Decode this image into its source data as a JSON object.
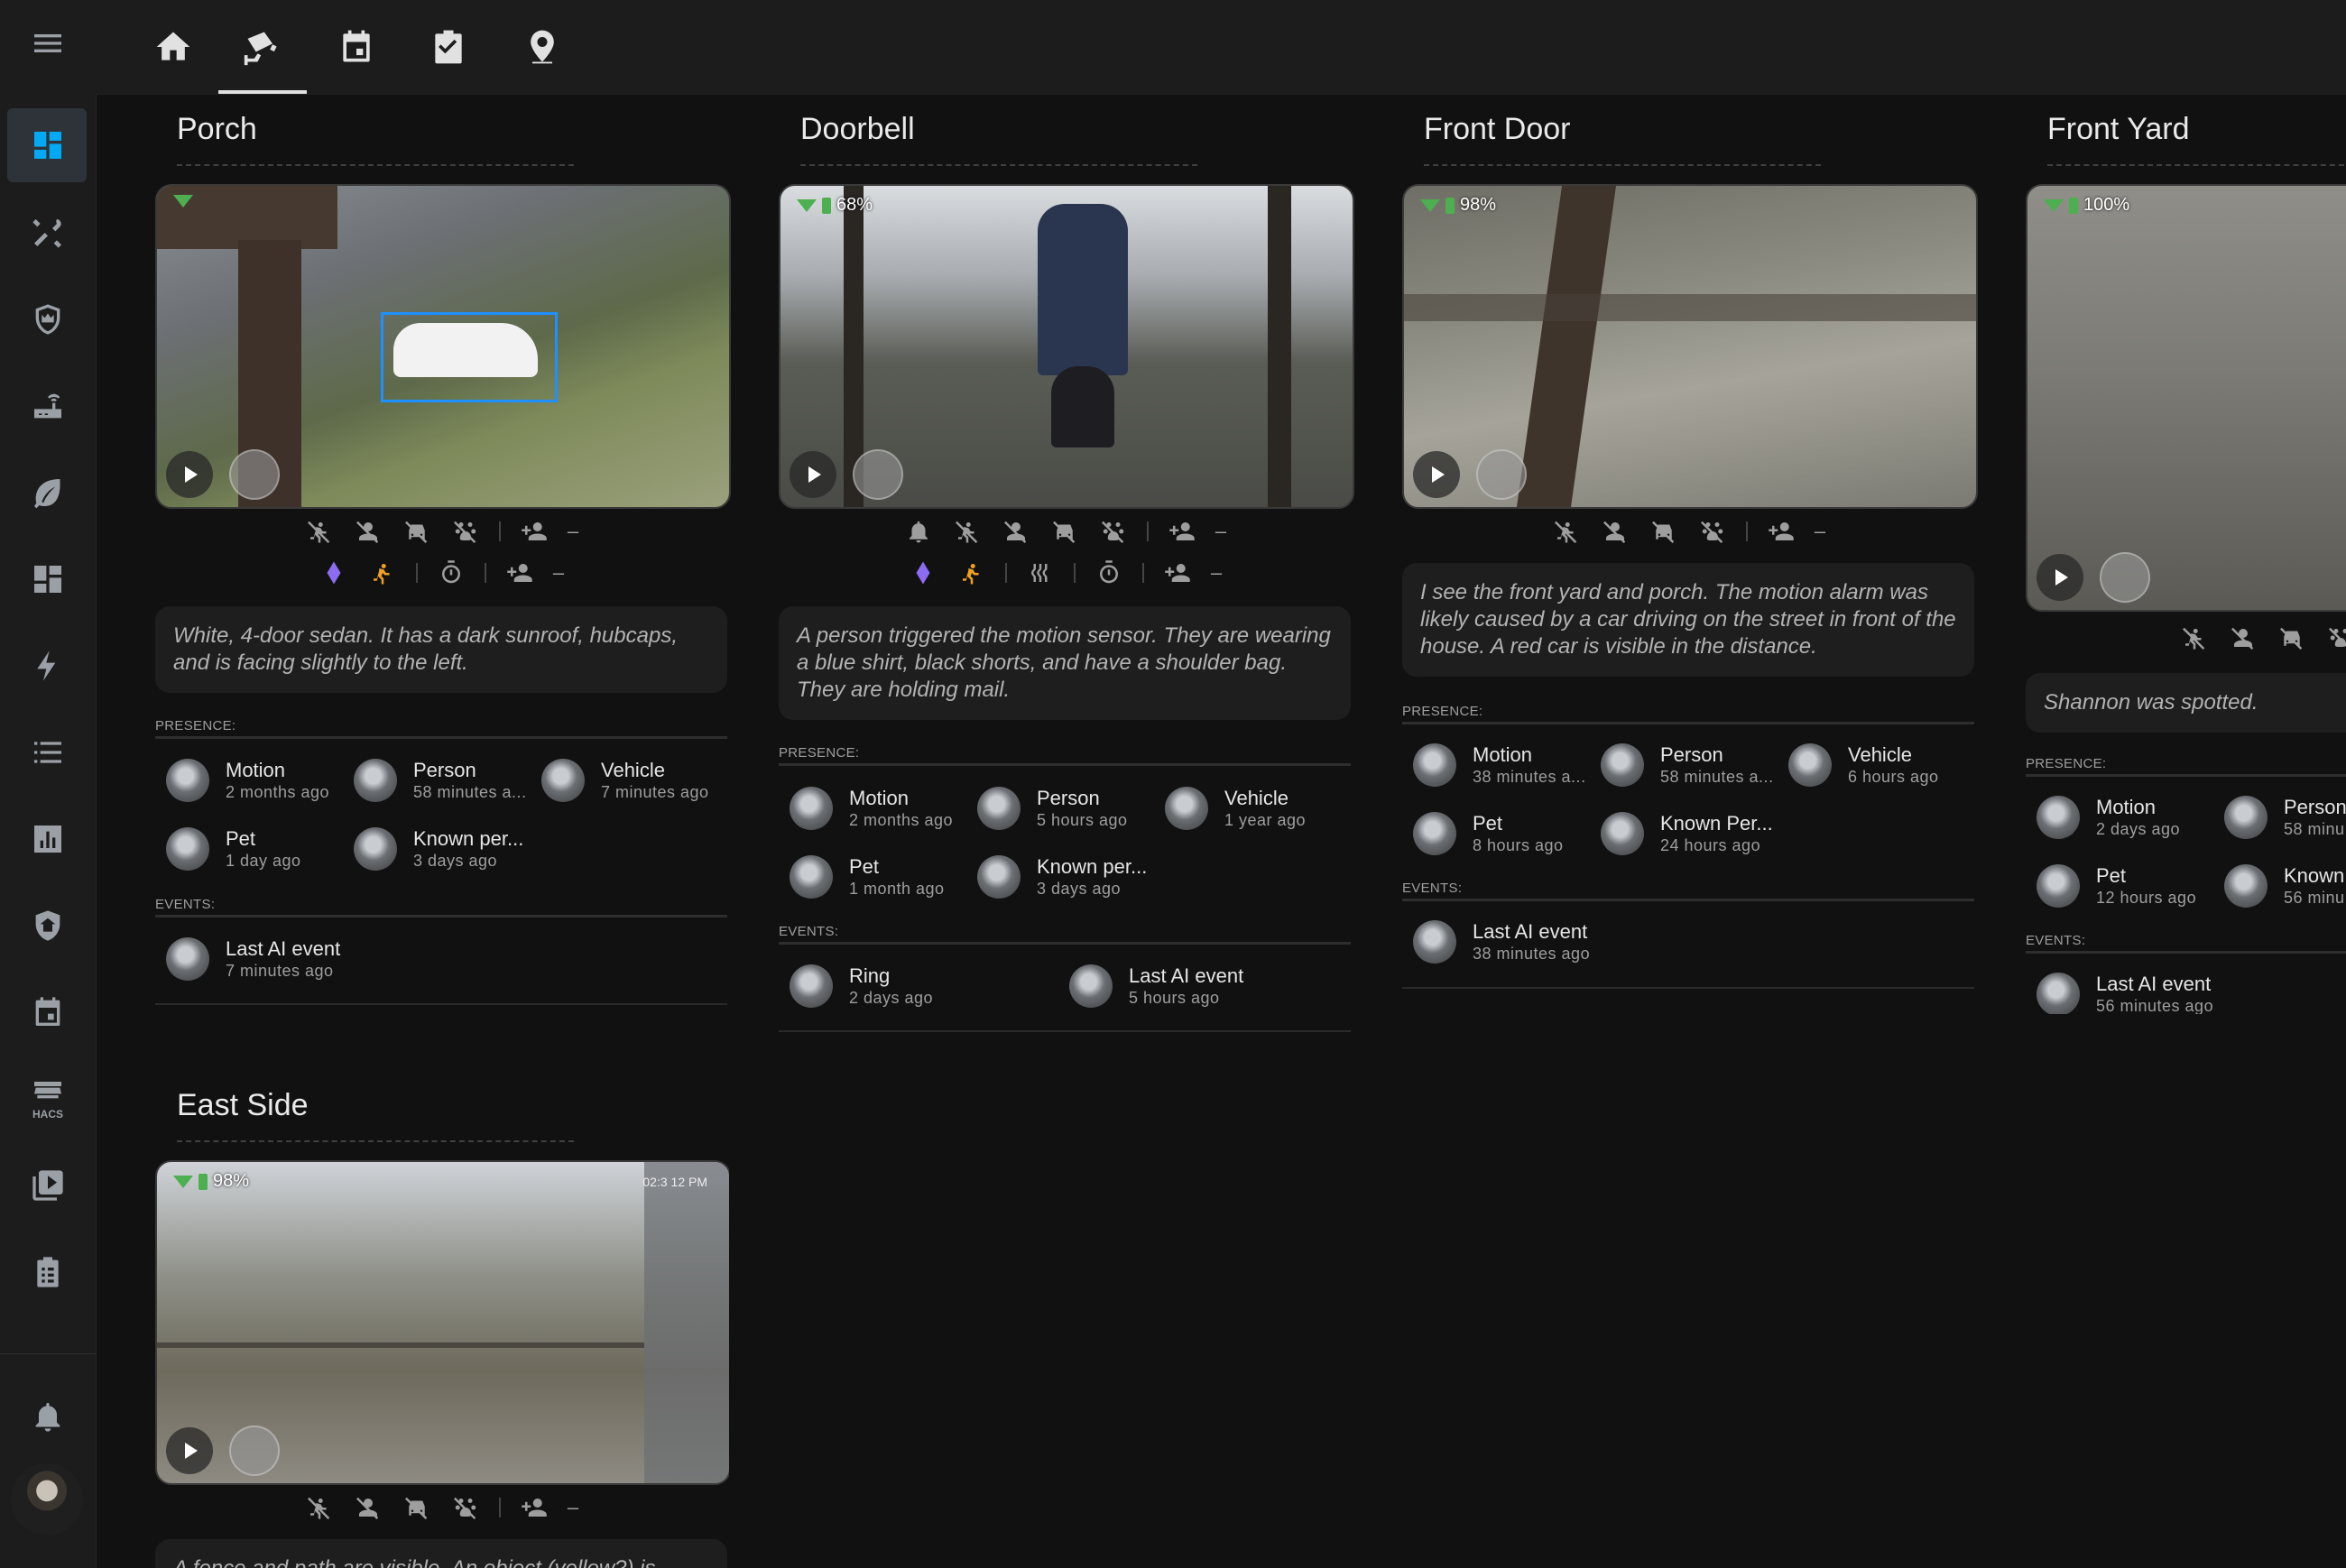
{
  "nav": {
    "sidebar": [
      "menu-icon",
      "dashboard-icon",
      "tools-icon",
      "shield-crown-icon",
      "router-icon",
      "leaf-icon",
      "grid-icon",
      "lightning-icon",
      "list-icon",
      "chart-icon",
      "home-shield-icon",
      "calendar-icon",
      "hacs-icon",
      "media-icon",
      "clipboard-icon",
      "bell-icon"
    ],
    "hacs_label": "HACS",
    "tabs": [
      "home-icon",
      "cctv-icon",
      "calendar-icon",
      "checklist-icon",
      "map-marker-icon"
    ],
    "active_tab": 1
  },
  "cards": {
    "porch": {
      "title": "Porch",
      "description": "White, 4-door sedan. It has a dark sunroof, hubcaps, and is facing slightly to the left.",
      "presence_label": "PRESENCE:",
      "events_label": "EVENTS:",
      "dash": "–",
      "presence": [
        {
          "name": "Motion",
          "time": "2 months ago"
        },
        {
          "name": "Person",
          "time": "58 minutes a..."
        },
        {
          "name": "Vehicle",
          "time": "7 minutes ago"
        },
        {
          "name": "Pet",
          "time": "1 day ago"
        },
        {
          "name": "Known per...",
          "time": "3 days ago"
        }
      ],
      "events": [
        {
          "name": "Last AI event",
          "time": "7 minutes ago"
        }
      ]
    },
    "doorbell": {
      "title": "Doorbell",
      "battery": "68%",
      "description": "A person triggered the motion sensor. They are wearing a blue shirt, black shorts, and have a shoulder bag. They are holding mail.",
      "presence_label": "PRESENCE:",
      "events_label": "EVENTS:",
      "dash": "–",
      "presence": [
        {
          "name": "Motion",
          "time": "2 months ago"
        },
        {
          "name": "Person",
          "time": "5 hours ago"
        },
        {
          "name": "Vehicle",
          "time": "1 year ago"
        },
        {
          "name": "Pet",
          "time": "1 month ago"
        },
        {
          "name": "Known per...",
          "time": "3 days ago"
        }
      ],
      "events": [
        {
          "name": "Ring",
          "time": "2 days ago"
        },
        {
          "name": "Last AI event",
          "time": "5 hours ago"
        }
      ]
    },
    "front_door": {
      "title": "Front Door",
      "battery": "98%",
      "description": "I see the front yard and porch. The motion alarm was likely caused by a car driving on the street in front of the house. A red car is visible in the distance.",
      "presence_label": "PRESENCE:",
      "events_label": "EVENTS:",
      "dash": "–",
      "presence": [
        {
          "name": "Motion",
          "time": "38 minutes a..."
        },
        {
          "name": "Person",
          "time": "58 minutes a..."
        },
        {
          "name": "Vehicle",
          "time": "6 hours ago"
        },
        {
          "name": "Pet",
          "time": "8 hours ago"
        },
        {
          "name": "Known Per...",
          "time": "24 hours ago"
        }
      ],
      "events": [
        {
          "name": "Last AI event",
          "time": "38 minutes ago"
        }
      ]
    },
    "front_yard": {
      "title": "Front Yard",
      "battery": "100%",
      "description": "Shannon was spotted.",
      "presence_label": "PRESENCE:",
      "events_label": "EVENTS:",
      "presence": [
        {
          "name": "Motion",
          "time": "2 days ago"
        },
        {
          "name": "Person",
          "time": "58 minu"
        },
        {
          "name": "Pet",
          "time": "12 hours ago"
        },
        {
          "name": "Known",
          "time": "56 minu"
        }
      ],
      "events": [
        {
          "name": "Last AI event",
          "time": "56 minutes ago"
        }
      ]
    },
    "east_side": {
      "title": "East Side",
      "battery": "98%",
      "timestamp": "02:3 12 PM",
      "description": "A fence and path are visible. An object (yellow?) is",
      "dash": "–"
    }
  }
}
